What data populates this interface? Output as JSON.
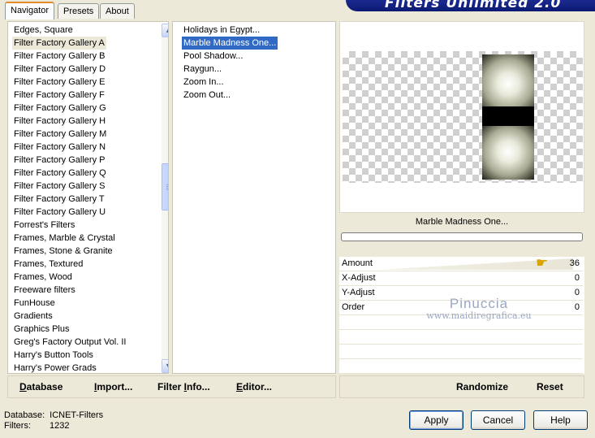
{
  "app": {
    "banner_title": "Filters Unlimited 2.0"
  },
  "tabs": [
    {
      "label": "Navigator",
      "active": true
    },
    {
      "label": "Presets",
      "active": false
    },
    {
      "label": "About",
      "active": false
    }
  ],
  "categories": [
    "Edges, Square",
    "Filter Factory Gallery A",
    "Filter Factory Gallery B",
    "Filter Factory Gallery D",
    "Filter Factory Gallery E",
    "Filter Factory Gallery F",
    "Filter Factory Gallery G",
    "Filter Factory Gallery H",
    "Filter Factory Gallery M",
    "Filter Factory Gallery N",
    "Filter Factory Gallery P",
    "Filter Factory Gallery Q",
    "Filter Factory Gallery S",
    "Filter Factory Gallery T",
    "Filter Factory Gallery U",
    "Forrest's Filters",
    "Frames, Marble & Crystal",
    "Frames, Stone & Granite",
    "Frames, Textured",
    "Frames, Wood",
    "Freeware filters",
    "FunHouse",
    "Gradients",
    "Graphics Plus",
    "Greg's Factory Output Vol. II",
    "Harry's Button Tools",
    "Harry's Power Grads"
  ],
  "selected_category": "Filter Factory Gallery A",
  "filters": [
    "Holidays in Egypt...",
    "Marble Madness One...",
    "Pool Shadow...",
    "Raygun...",
    "Zoom In...",
    "Zoom Out..."
  ],
  "selected_filter": "Marble Madness One...",
  "preview": {
    "filter_name": "Marble Madness One..."
  },
  "params": [
    {
      "label": "Amount",
      "value": "36"
    },
    {
      "label": "X-Adjust",
      "value": "0"
    },
    {
      "label": "Y-Adjust",
      "value": "0"
    },
    {
      "label": "Order",
      "value": "0"
    }
  ],
  "watermark": {
    "line1": "Pinuccia",
    "line2": "www.maidiregrafica.eu"
  },
  "left_buttons": {
    "database": {
      "underlined": "D",
      "rest": "atabase"
    },
    "import": {
      "prefix": "",
      "underlined": "I",
      "rest": "mport..."
    },
    "filter_info": {
      "prefix": "Filter ",
      "underlined": "I",
      "rest": "nfo..."
    },
    "editor": {
      "underlined": "E",
      "rest": "ditor..."
    }
  },
  "right_buttons": {
    "randomize": "Randomize",
    "reset": "Reset"
  },
  "info": {
    "database_label": "Database:",
    "database_value": "ICNET-Filters",
    "filters_label": "Filters:",
    "filters_value": "1232"
  },
  "dialog_buttons": {
    "apply": "Apply",
    "cancel": "Cancel",
    "help": "Help"
  },
  "colors": {
    "selection": "#316ac5",
    "banner": "#0c1a73",
    "tab_accent": "#e68b2c"
  }
}
